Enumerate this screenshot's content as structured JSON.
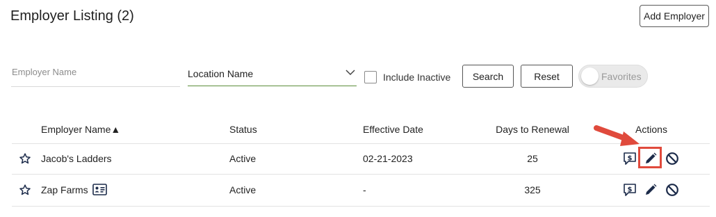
{
  "header": {
    "title": "Employer Listing (2)",
    "add_button": "Add Employer"
  },
  "filters": {
    "employer_name_placeholder": "Employer Name",
    "location_select_value": "Location Name",
    "include_inactive_label": "Include Inactive",
    "search_button": "Search",
    "reset_button": "Reset",
    "favorites_toggle_label": "Favorites"
  },
  "table": {
    "columns": {
      "employer_name": "Employer Name▲",
      "status": "Status",
      "effective_date": "Effective Date",
      "days_to_renewal": "Days to Renewal",
      "actions": "Actions"
    },
    "rows": [
      {
        "name": "Jacob's Ladders",
        "status": "Active",
        "effective_date": "02-21-2023",
        "days_to_renewal": "25"
      },
      {
        "name": "Zap Farms",
        "status": "Active",
        "effective_date": "-",
        "days_to_renewal": "325"
      }
    ]
  },
  "icons": {
    "favorite": "star-outline-icon",
    "contact_card": "id-card-icon",
    "billing": "dollar-message-icon",
    "edit": "pencil-icon",
    "deactivate": "ban-icon",
    "callout": "red-arrow-annotation"
  },
  "colors": {
    "icon_navy": "#1c2b4a",
    "annotation_red": "#e04a3c",
    "select_underline": "#5b8c3a"
  }
}
